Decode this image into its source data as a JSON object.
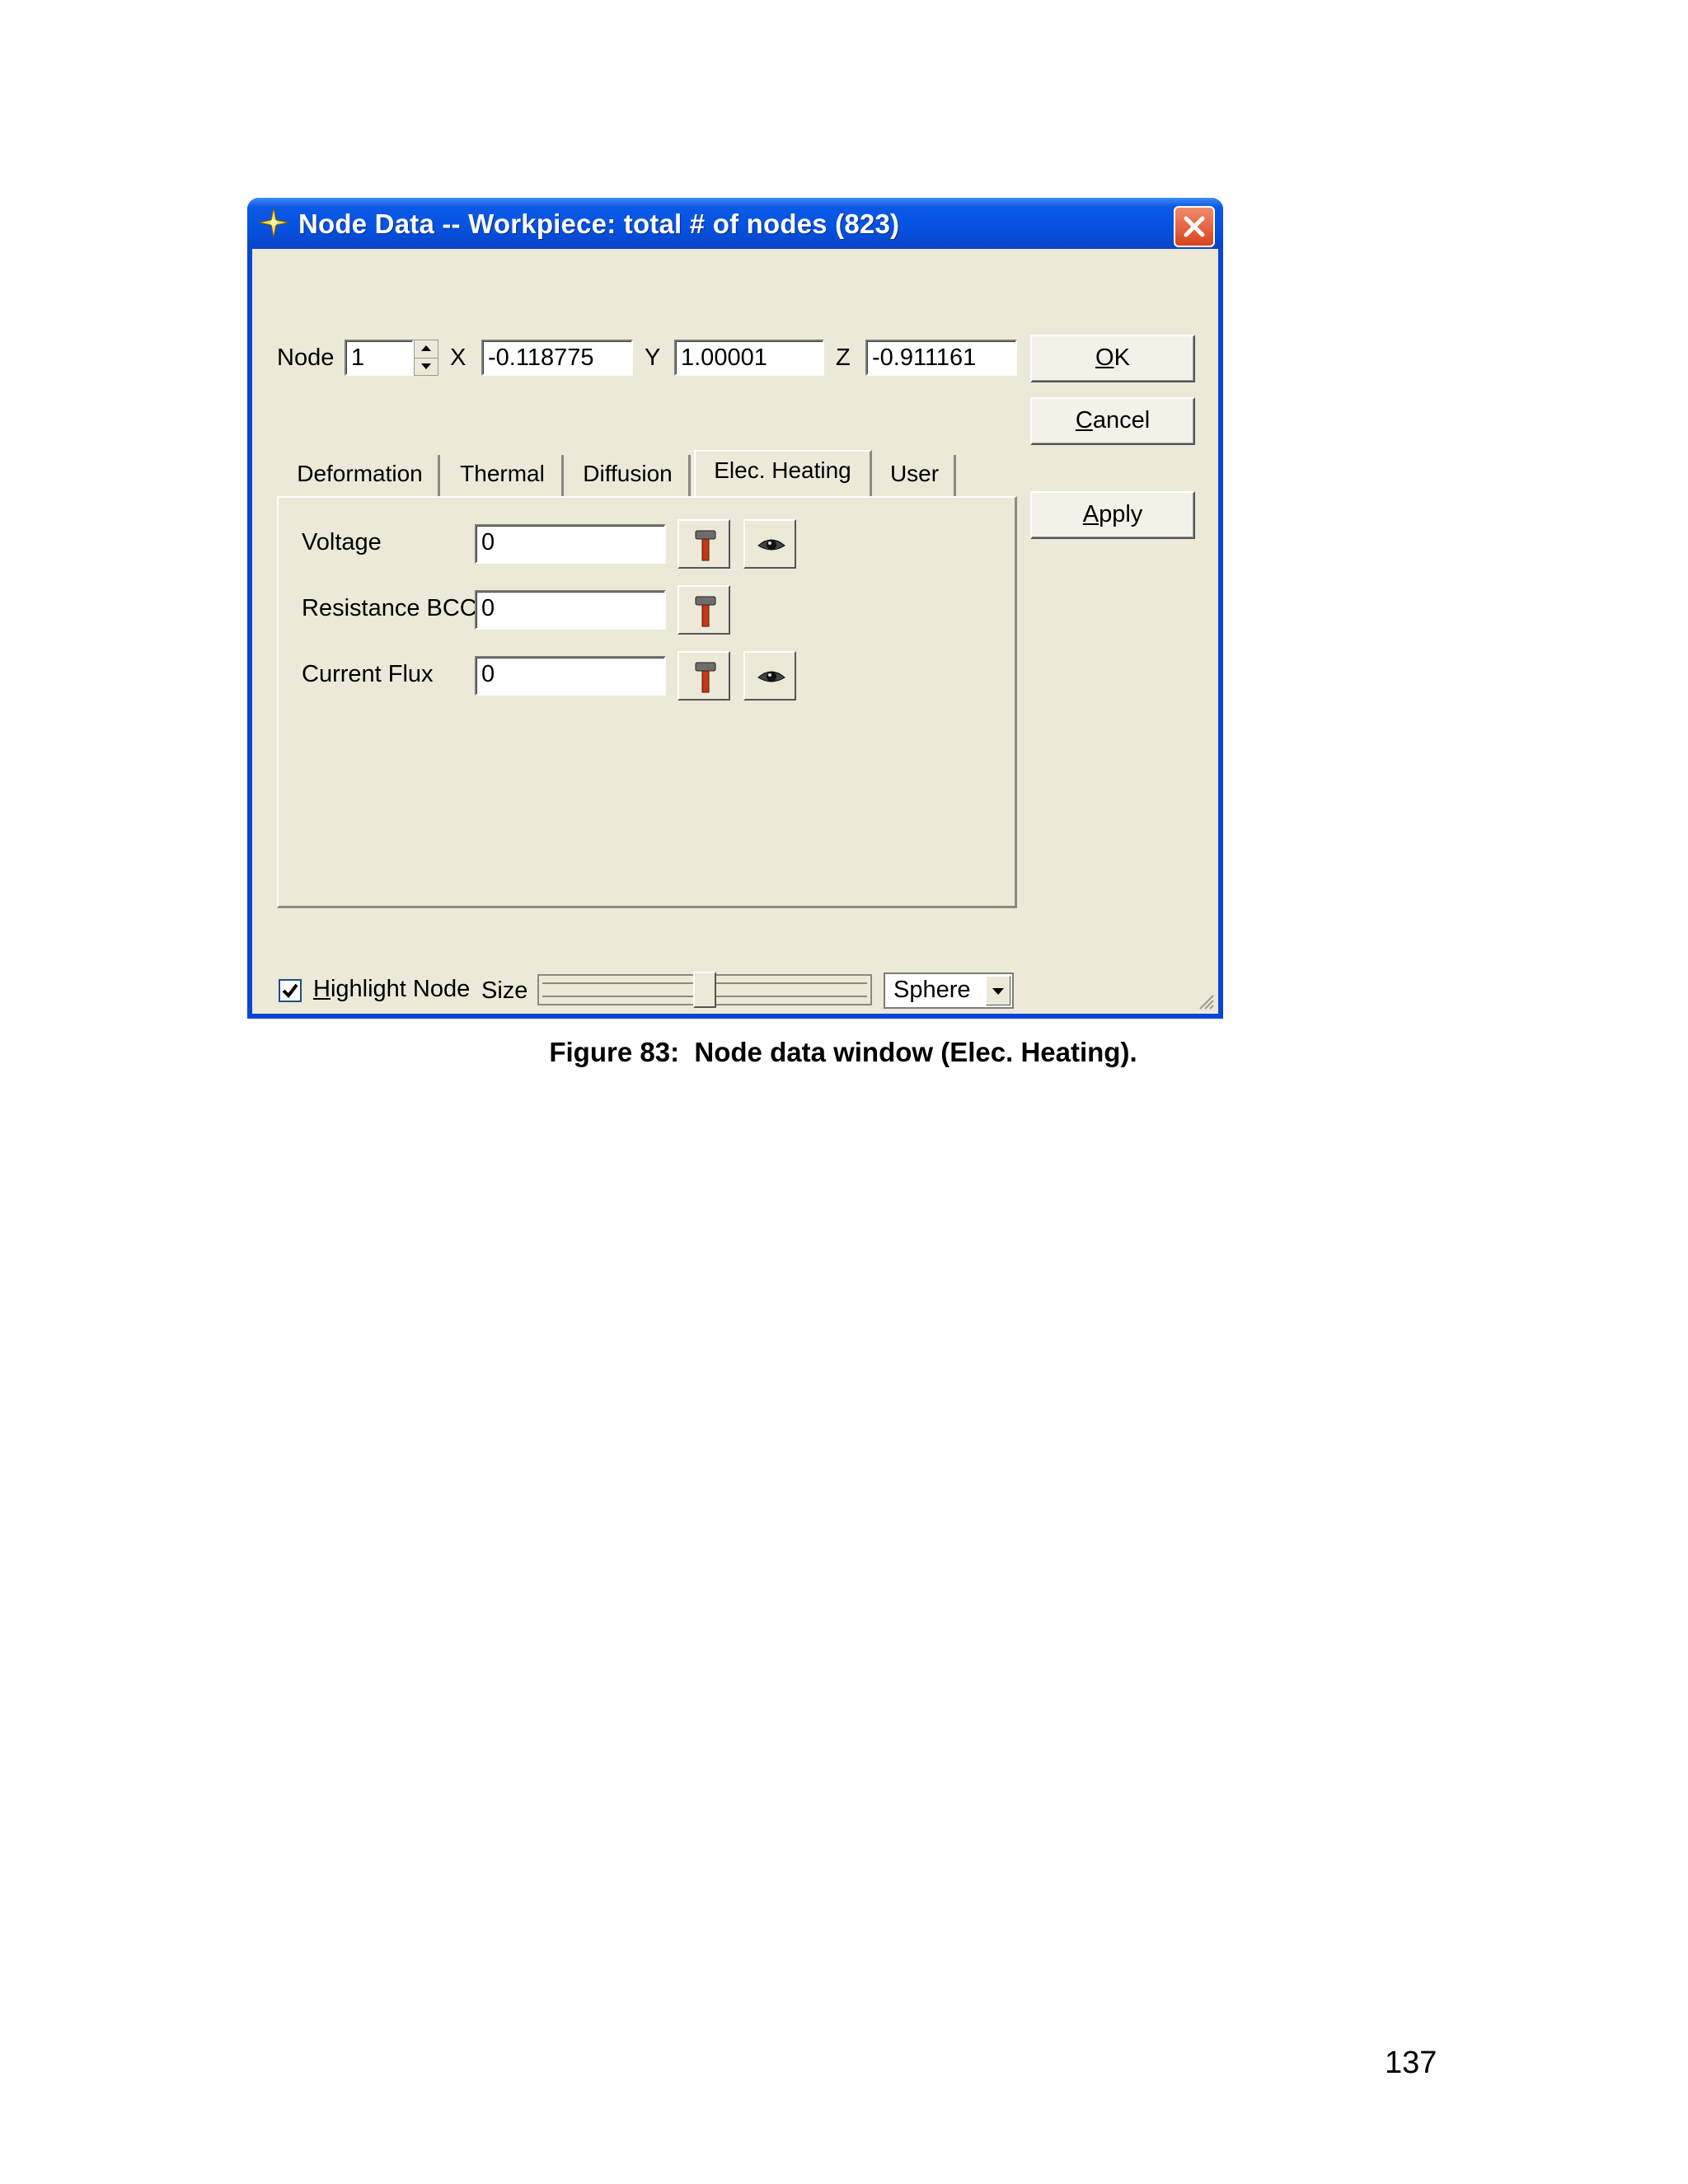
{
  "window": {
    "title": "Node Data -- Workpiece: total # of nodes (823)"
  },
  "node_row": {
    "node_label": "Node",
    "node_value": "1",
    "x_label": "X",
    "x_value": "-0.118775",
    "y_label": "Y",
    "y_value": "1.00001",
    "z_label": "Z",
    "z_value": "-0.911161"
  },
  "buttons": {
    "ok_mnemonic": "O",
    "ok_rest": "K",
    "cancel_mnemonic": "C",
    "cancel_rest": "ancel",
    "apply_mnemonic": "A",
    "apply_rest": "pply"
  },
  "tabs": [
    {
      "label": "Deformation",
      "active": false
    },
    {
      "label": "Thermal",
      "active": false
    },
    {
      "label": "Diffusion",
      "active": false
    },
    {
      "label": "Elec. Heating",
      "active": true
    },
    {
      "label": "User",
      "active": false
    }
  ],
  "fields": [
    {
      "label": "Voltage",
      "value": "0",
      "has_view_button": true
    },
    {
      "label": "Resistance BCC",
      "value": "0",
      "has_view_button": false
    },
    {
      "label": "Current Flux",
      "value": "0",
      "has_view_button": true
    }
  ],
  "bottom": {
    "highlight_checked": true,
    "highlight_mnemonic": "H",
    "highlight_rest": "ighlight Node",
    "size_label": "Size",
    "size_slider_fraction": 0.5,
    "shape_value": "Sphere"
  },
  "caption": "Figure 83:  Node data window (Elec. Heating).",
  "page_number": "137",
  "colors": {
    "title_bar": "#0551e0",
    "dialog_face": "#ece9d8",
    "close_button": "#d8431e"
  },
  "icons": {
    "title": "node-star-icon",
    "tool": "hammer-icon",
    "view": "eye-icon"
  }
}
